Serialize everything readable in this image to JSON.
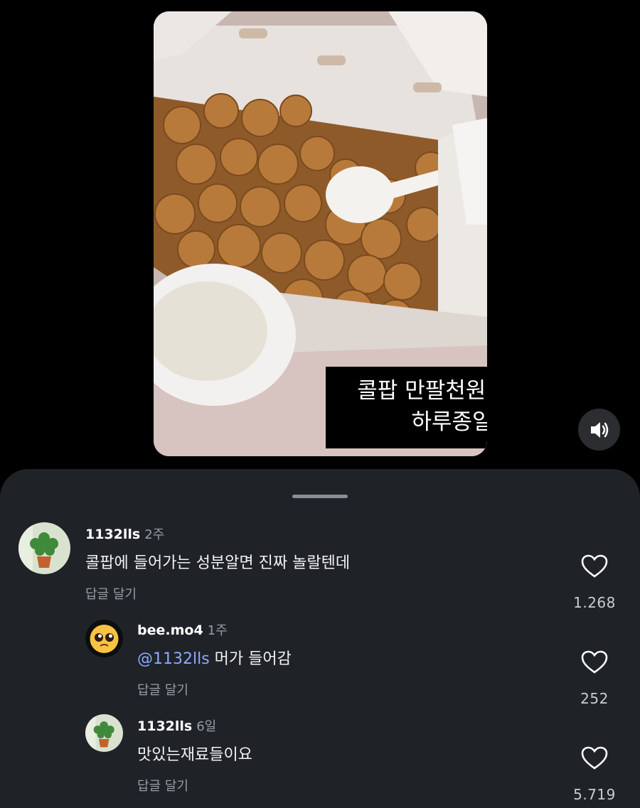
{
  "video": {
    "caption_line1": "콜팝 만팔천원어치 시키고",
    "caption_line2": "하루종일 먹음",
    "mute_icon": "speaker-volume-icon"
  },
  "comments": [
    {
      "username": "1132lls",
      "time": "2주",
      "text": "콜팝에 들어가는 성분알면 진짜 놀랄텐데",
      "reply_label": "답글 달기",
      "likes": "1.268",
      "avatar_icon": "plant-avatar"
    },
    {
      "username": "bee.mo4",
      "time": "1주",
      "mention": "@1132lls",
      "text": " 머가 들어감",
      "reply_label": "답글 달기",
      "likes": "252",
      "avatar_icon": "pleading-face-emoji"
    },
    {
      "username": "1132lls",
      "time": "6일",
      "text": "맛있는재료들이요",
      "reply_label": "답글 달기",
      "likes": "5.719",
      "avatar_icon": "plant-avatar"
    }
  ],
  "colors": {
    "sheet_bg": "#1f2328",
    "mention": "#8ea8ff",
    "muted_text": "#9a9ea4"
  }
}
